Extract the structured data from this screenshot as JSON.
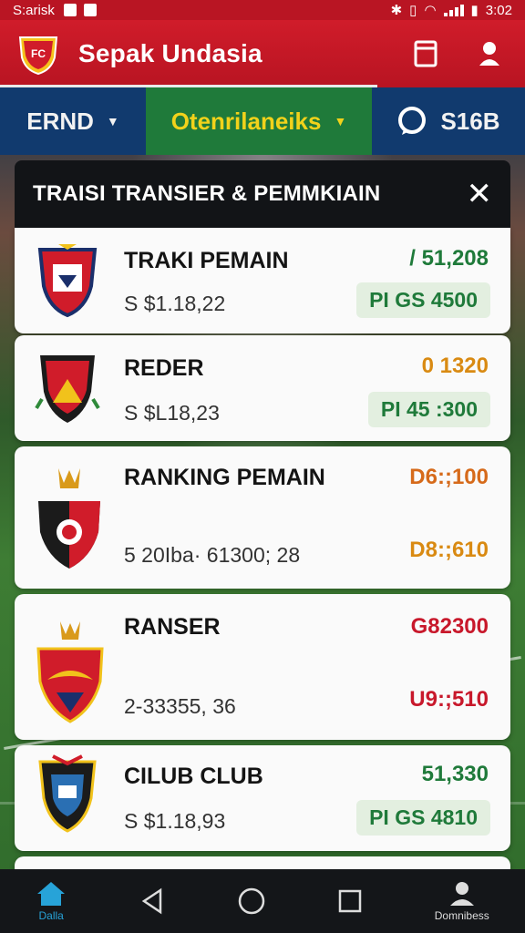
{
  "status_bar": {
    "carrier": "S:arisk",
    "time": "3:02",
    "status_icons": [
      "notification-icon",
      "image-icon",
      "bluetooth-icon",
      "vibrate-icon",
      "wifi-icon",
      "signal-icon",
      "battery-icon"
    ]
  },
  "app_bar": {
    "title": "Sepak Undasia",
    "actions": [
      "bookmark-icon",
      "profile-icon"
    ]
  },
  "tabs": [
    {
      "label": "ERND",
      "selected": false
    },
    {
      "label": "Otenrilaneiks",
      "selected": true
    },
    {
      "label": "S16B",
      "selected": false,
      "icon": "chat-icon"
    }
  ],
  "panel": {
    "title": "TRAISI TRANSIER  & PEMMKIAIN",
    "cards": [
      {
        "name": "TRAKI PEMAIN",
        "sub": "S $1.18,22",
        "value": "/ 51,208",
        "value_color": "#1f7a3a",
        "pill": "PI GS 4500"
      },
      {
        "name": "REDER",
        "sub": "S $L18,23",
        "value": "0 1320",
        "value_color": "#d98a12",
        "pill": "PI 45 :300"
      },
      {
        "name": "RANKING PEMAIN",
        "sub": "5 20Iba· 61300; 28",
        "value": "D6:;100",
        "value_color": "#d66a1a",
        "value2": "D8:;610",
        "value2_color": "#d98a12"
      },
      {
        "name": "RANSER",
        "sub": "2-33355, 36",
        "value": "G82300",
        "value_color": "#c8182b",
        "value2": "U9:;510",
        "value2_color": "#c8182b"
      },
      {
        "name": "CILUB CLUB",
        "sub": "S $1.18,93",
        "value": "51,330",
        "value_color": "#1f7a3a",
        "pill": "PI GS 4810"
      }
    ]
  },
  "bottom_nav": {
    "home_label": "Dalla",
    "profile_label": "Domnibess"
  },
  "colors": {
    "brand_red": "#c8182b",
    "tab_blue": "#113a6e",
    "tab_green": "#1f7a3a",
    "tab_yellow": "#f1d21b"
  }
}
